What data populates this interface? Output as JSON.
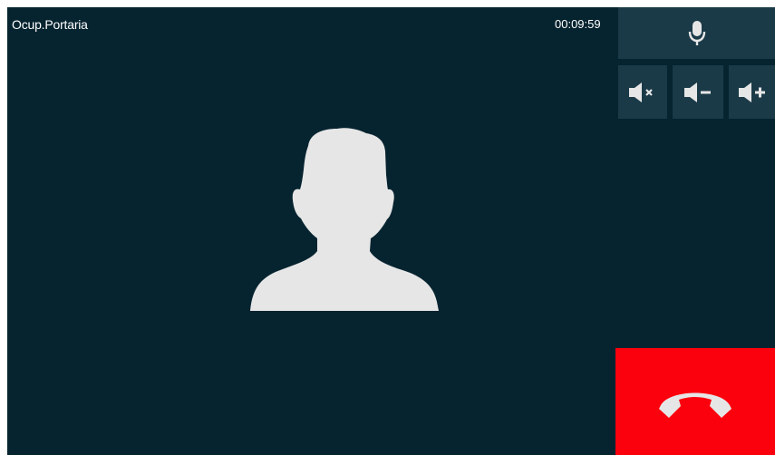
{
  "call": {
    "caller_name": "Ocup.Portaria",
    "duration": "00:09:59"
  },
  "controls": {
    "microphone_icon": "microphone-icon",
    "mute_icon": "speaker-mute-icon",
    "volume_down_icon": "speaker-minus-icon",
    "volume_up_icon": "speaker-plus-icon",
    "hangup_icon": "phone-hangup-icon"
  },
  "colors": {
    "background": "#062430",
    "button": "#1b3a48",
    "hangup": "#fb000d",
    "icon": "#e6e6e6"
  }
}
